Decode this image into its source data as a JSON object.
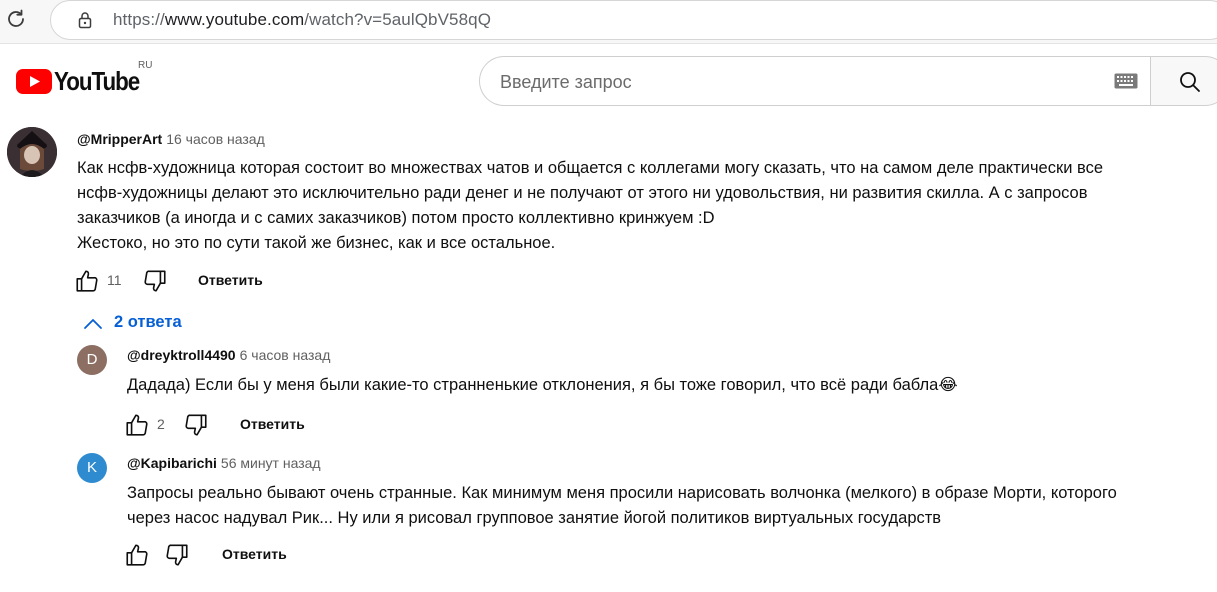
{
  "browser": {
    "url_prefix": "https://",
    "url_host": "www.youtube.com",
    "url_path": "/watch?v=5aulQbV58qQ"
  },
  "header": {
    "logo_text": "YouTube",
    "region": "RU",
    "search_placeholder": "Введите запрос"
  },
  "comments": [
    {
      "author": "@MripperArt",
      "time": "16 часов назад",
      "lines": [
        "Как нсфв-художница которая состоит во множествах чатов и общается с коллегами могу сказать, что на самом деле практически все",
        "нсфв-художницы делают это исключительно ради денег и не получают от этого ни удовольствия, ни развития скилла. А с запросов",
        "заказчиков (а иногда и с самих заказчиков) потом просто коллективно кринжуем :D",
        "Жестоко, но это по сути такой же бизнес, как и все остальное."
      ],
      "likes": "11",
      "reply_label": "Ответить"
    }
  ],
  "replies_toggle": "2 ответа",
  "replies": [
    {
      "author": "@dreyktroll4490",
      "time": "6 часов назад",
      "avatar_letter": "D",
      "avatar_color": "#8d6e63",
      "lines": [
        "Дадада) Если бы у меня были какие-то странненькие отклонения, я бы тоже говорил, что всё ради бабла😂"
      ],
      "likes": "2",
      "reply_label": "Ответить"
    },
    {
      "author": "@Kapibarichi",
      "time": "56 минут назад",
      "avatar_letter": "K",
      "avatar_color": "#2e8bd0",
      "lines": [
        "Запросы реально бывают очень странные. Как минимум меня просили нарисовать волчонка (мелкого) в образе Морти, которого",
        "через насос надувал Рик... Ну или я рисовал групповое занятие йогой политиков виртуальных государств"
      ],
      "likes": "",
      "reply_label": "Ответить"
    }
  ]
}
